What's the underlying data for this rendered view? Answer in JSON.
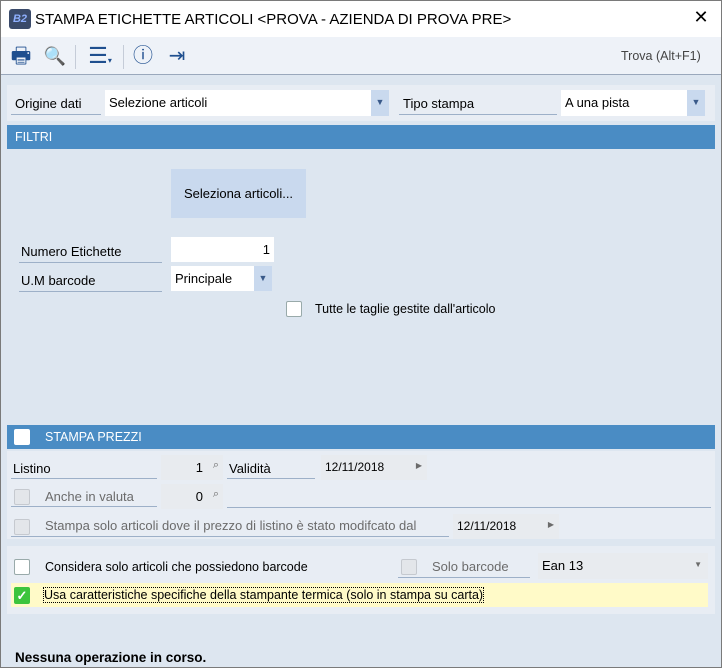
{
  "window": {
    "title": "STAMPA ETICHETTE ARTICOLI <PROVA - AZIENDA DI PROVA PRE>",
    "logo": "B2",
    "close": "✕"
  },
  "toolbar": {
    "find": "Trova (Alt+F1)",
    "icons": [
      "printer-icon",
      "print-preview-icon",
      "menu-icon",
      "help-icon",
      "exit-icon"
    ]
  },
  "origine": {
    "label": "Origine dati",
    "value": "Selezione articoli"
  },
  "tipo": {
    "label": "Tipo stampa",
    "value": "A una pista"
  },
  "filtri": {
    "header": "FILTRI",
    "select_button": "Seleziona articoli...",
    "num_label": "Numero Etichette",
    "num_value": "1",
    "um_label": "U.M barcode",
    "um_value": "Principale",
    "taglie_label": "Tutte le taglie gestite dall'articolo",
    "taglie_checked": false
  },
  "prezzi": {
    "header": "STAMPA PREZZI",
    "checked": false,
    "listino_label": "Listino",
    "listino_value": "1",
    "validita_label": "Validità",
    "validita_value": "12/11/2018",
    "valuta_label": "Anche in valuta",
    "valuta_value": "0",
    "modificato_label": "Stampa solo articoli dove il prezzo di listino è stato modifcato dal",
    "modificato_value": "12/11/2018"
  },
  "opzioni": {
    "barcode_label": "Considera solo articoli che possiedono barcode",
    "solo_barcode_label": "Solo barcode",
    "barcode_type": "Ean 13",
    "termica_label": "Usa caratteristiche specifiche della stampante termica (solo in stampa su carta)",
    "termica_checked": true
  },
  "status": "Nessuna operazione in corso.",
  "colors": {
    "header": "#4a8cc4",
    "checked": "#3cc43c",
    "highlight": "#fffac8"
  }
}
